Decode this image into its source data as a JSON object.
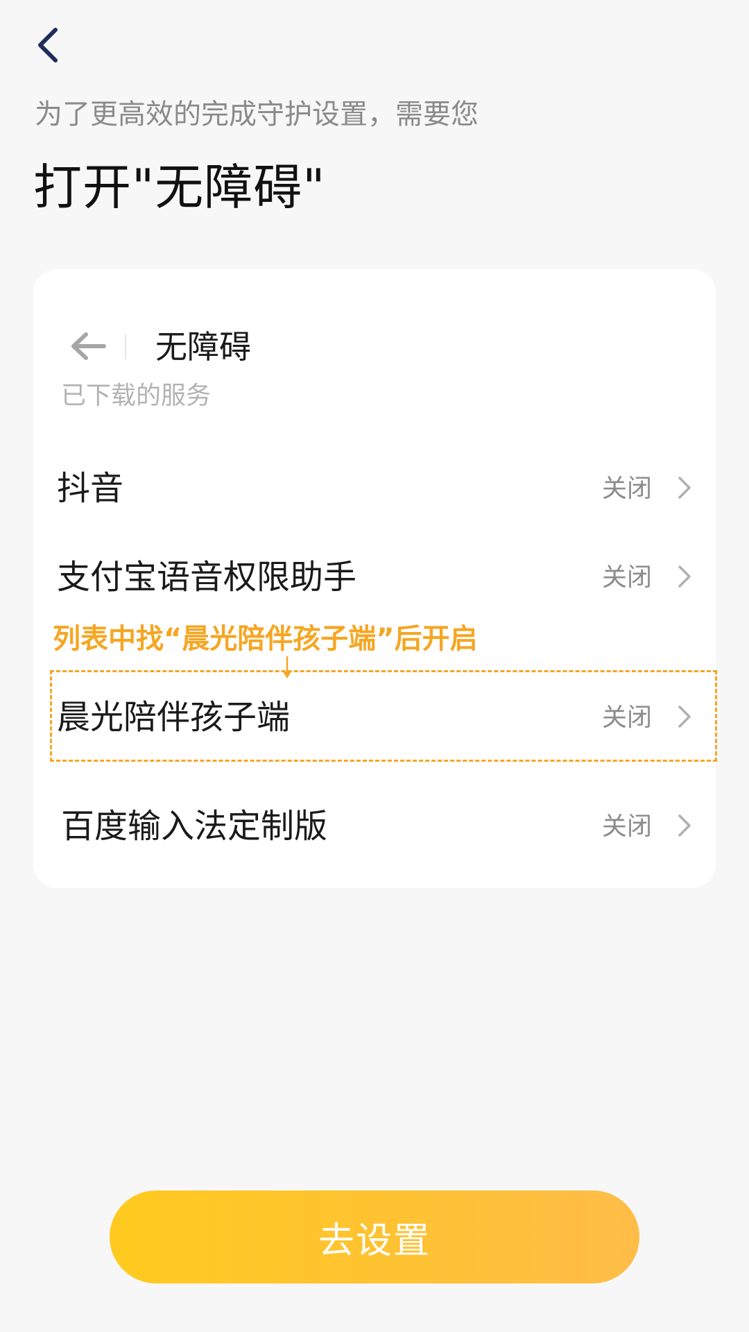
{
  "header": {
    "back_icon": "chevron-left-icon",
    "subtitle": "为了更高效的完成守护设置，需要您",
    "title": "打开\"无障碍\""
  },
  "card": {
    "mock_header": {
      "back_icon": "arrow-left-icon",
      "title": "无障碍"
    },
    "section_label": "已下载的服务",
    "items": [
      {
        "label": "抖音",
        "status": "关闭"
      },
      {
        "label": "支付宝语音权限助手",
        "status": "关闭"
      },
      {
        "label": "晨光陪伴孩子端",
        "status": "关闭"
      },
      {
        "label": "百度输入法定制版",
        "status": "关闭"
      }
    ],
    "hint": "列表中找“晨光陪伴孩子端”后开启"
  },
  "cta": {
    "label": "去设置"
  },
  "colors": {
    "accent": "#f5a623",
    "button_start": "#ffca1f",
    "button_end": "#ffbd48",
    "nav_icon": "#1f2d5c",
    "background": "#f7f7f7"
  }
}
